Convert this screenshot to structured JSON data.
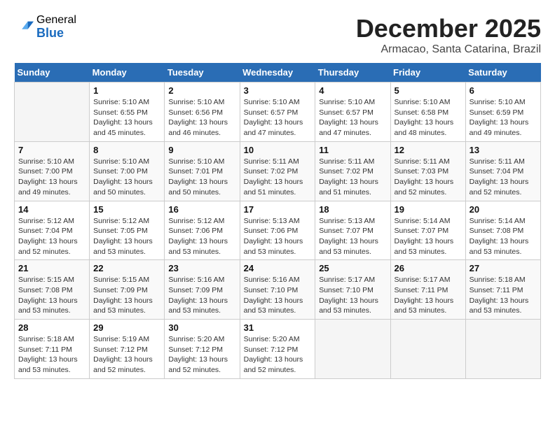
{
  "logo": {
    "general": "General",
    "blue": "Blue"
  },
  "title": "December 2025",
  "subtitle": "Armacao, Santa Catarina, Brazil",
  "headers": [
    "Sunday",
    "Monday",
    "Tuesday",
    "Wednesday",
    "Thursday",
    "Friday",
    "Saturday"
  ],
  "weeks": [
    [
      {
        "day": "",
        "info": ""
      },
      {
        "day": "1",
        "info": "Sunrise: 5:10 AM\nSunset: 6:55 PM\nDaylight: 13 hours\nand 45 minutes."
      },
      {
        "day": "2",
        "info": "Sunrise: 5:10 AM\nSunset: 6:56 PM\nDaylight: 13 hours\nand 46 minutes."
      },
      {
        "day": "3",
        "info": "Sunrise: 5:10 AM\nSunset: 6:57 PM\nDaylight: 13 hours\nand 47 minutes."
      },
      {
        "day": "4",
        "info": "Sunrise: 5:10 AM\nSunset: 6:57 PM\nDaylight: 13 hours\nand 47 minutes."
      },
      {
        "day": "5",
        "info": "Sunrise: 5:10 AM\nSunset: 6:58 PM\nDaylight: 13 hours\nand 48 minutes."
      },
      {
        "day": "6",
        "info": "Sunrise: 5:10 AM\nSunset: 6:59 PM\nDaylight: 13 hours\nand 49 minutes."
      }
    ],
    [
      {
        "day": "7",
        "info": "Sunrise: 5:10 AM\nSunset: 7:00 PM\nDaylight: 13 hours\nand 49 minutes."
      },
      {
        "day": "8",
        "info": "Sunrise: 5:10 AM\nSunset: 7:00 PM\nDaylight: 13 hours\nand 50 minutes."
      },
      {
        "day": "9",
        "info": "Sunrise: 5:10 AM\nSunset: 7:01 PM\nDaylight: 13 hours\nand 50 minutes."
      },
      {
        "day": "10",
        "info": "Sunrise: 5:11 AM\nSunset: 7:02 PM\nDaylight: 13 hours\nand 51 minutes."
      },
      {
        "day": "11",
        "info": "Sunrise: 5:11 AM\nSunset: 7:02 PM\nDaylight: 13 hours\nand 51 minutes."
      },
      {
        "day": "12",
        "info": "Sunrise: 5:11 AM\nSunset: 7:03 PM\nDaylight: 13 hours\nand 52 minutes."
      },
      {
        "day": "13",
        "info": "Sunrise: 5:11 AM\nSunset: 7:04 PM\nDaylight: 13 hours\nand 52 minutes."
      }
    ],
    [
      {
        "day": "14",
        "info": "Sunrise: 5:12 AM\nSunset: 7:04 PM\nDaylight: 13 hours\nand 52 minutes."
      },
      {
        "day": "15",
        "info": "Sunrise: 5:12 AM\nSunset: 7:05 PM\nDaylight: 13 hours\nand 53 minutes."
      },
      {
        "day": "16",
        "info": "Sunrise: 5:12 AM\nSunset: 7:06 PM\nDaylight: 13 hours\nand 53 minutes."
      },
      {
        "day": "17",
        "info": "Sunrise: 5:13 AM\nSunset: 7:06 PM\nDaylight: 13 hours\nand 53 minutes."
      },
      {
        "day": "18",
        "info": "Sunrise: 5:13 AM\nSunset: 7:07 PM\nDaylight: 13 hours\nand 53 minutes."
      },
      {
        "day": "19",
        "info": "Sunrise: 5:14 AM\nSunset: 7:07 PM\nDaylight: 13 hours\nand 53 minutes."
      },
      {
        "day": "20",
        "info": "Sunrise: 5:14 AM\nSunset: 7:08 PM\nDaylight: 13 hours\nand 53 minutes."
      }
    ],
    [
      {
        "day": "21",
        "info": "Sunrise: 5:15 AM\nSunset: 7:08 PM\nDaylight: 13 hours\nand 53 minutes."
      },
      {
        "day": "22",
        "info": "Sunrise: 5:15 AM\nSunset: 7:09 PM\nDaylight: 13 hours\nand 53 minutes."
      },
      {
        "day": "23",
        "info": "Sunrise: 5:16 AM\nSunset: 7:09 PM\nDaylight: 13 hours\nand 53 minutes."
      },
      {
        "day": "24",
        "info": "Sunrise: 5:16 AM\nSunset: 7:10 PM\nDaylight: 13 hours\nand 53 minutes."
      },
      {
        "day": "25",
        "info": "Sunrise: 5:17 AM\nSunset: 7:10 PM\nDaylight: 13 hours\nand 53 minutes."
      },
      {
        "day": "26",
        "info": "Sunrise: 5:17 AM\nSunset: 7:11 PM\nDaylight: 13 hours\nand 53 minutes."
      },
      {
        "day": "27",
        "info": "Sunrise: 5:18 AM\nSunset: 7:11 PM\nDaylight: 13 hours\nand 53 minutes."
      }
    ],
    [
      {
        "day": "28",
        "info": "Sunrise: 5:18 AM\nSunset: 7:11 PM\nDaylight: 13 hours\nand 53 minutes."
      },
      {
        "day": "29",
        "info": "Sunrise: 5:19 AM\nSunset: 7:12 PM\nDaylight: 13 hours\nand 52 minutes."
      },
      {
        "day": "30",
        "info": "Sunrise: 5:20 AM\nSunset: 7:12 PM\nDaylight: 13 hours\nand 52 minutes."
      },
      {
        "day": "31",
        "info": "Sunrise: 5:20 AM\nSunset: 7:12 PM\nDaylight: 13 hours\nand 52 minutes."
      },
      {
        "day": "",
        "info": ""
      },
      {
        "day": "",
        "info": ""
      },
      {
        "day": "",
        "info": ""
      }
    ]
  ]
}
